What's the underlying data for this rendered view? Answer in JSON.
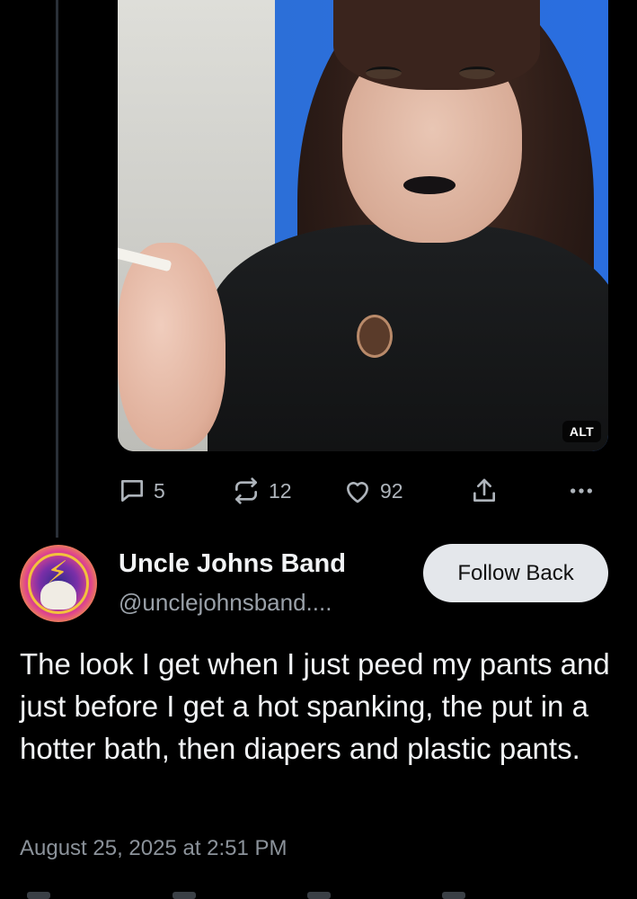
{
  "previous_post": {
    "media": {
      "alt_badge": "ALT"
    },
    "actions": {
      "reply_count": "5",
      "repost_count": "12",
      "like_count": "92"
    }
  },
  "post": {
    "author": {
      "display_name": "Uncle Johns Band",
      "handle": "@unclejohnsband...."
    },
    "follow_button_label": "Follow Back",
    "text": "The look I get when I just peed my pants and just before I get a hot spanking, the put in a hotter bath, then diapers and plastic pants.",
    "timestamp": "August 25, 2025 at 2:51 PM"
  },
  "colors": {
    "background": "#000000",
    "text_primary": "#f1f3f5",
    "text_secondary": "#9aa1a9",
    "follow_button_bg": "#e4e7eb"
  },
  "icons": [
    "reply-icon",
    "repost-icon",
    "like-icon",
    "share-icon",
    "more-icon"
  ]
}
